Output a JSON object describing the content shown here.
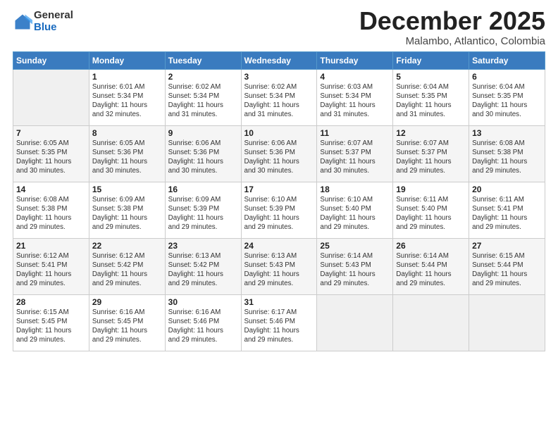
{
  "logo": {
    "general": "General",
    "blue": "Blue"
  },
  "title": "December 2025",
  "subtitle": "Malambo, Atlantico, Colombia",
  "weekdays": [
    "Sunday",
    "Monday",
    "Tuesday",
    "Wednesday",
    "Thursday",
    "Friday",
    "Saturday"
  ],
  "weeks": [
    [
      {
        "date": "",
        "info": ""
      },
      {
        "date": "1",
        "info": "Sunrise: 6:01 AM\nSunset: 5:34 PM\nDaylight: 11 hours\nand 32 minutes."
      },
      {
        "date": "2",
        "info": "Sunrise: 6:02 AM\nSunset: 5:34 PM\nDaylight: 11 hours\nand 31 minutes."
      },
      {
        "date": "3",
        "info": "Sunrise: 6:02 AM\nSunset: 5:34 PM\nDaylight: 11 hours\nand 31 minutes."
      },
      {
        "date": "4",
        "info": "Sunrise: 6:03 AM\nSunset: 5:34 PM\nDaylight: 11 hours\nand 31 minutes."
      },
      {
        "date": "5",
        "info": "Sunrise: 6:04 AM\nSunset: 5:35 PM\nDaylight: 11 hours\nand 31 minutes."
      },
      {
        "date": "6",
        "info": "Sunrise: 6:04 AM\nSunset: 5:35 PM\nDaylight: 11 hours\nand 30 minutes."
      }
    ],
    [
      {
        "date": "7",
        "info": "Sunrise: 6:05 AM\nSunset: 5:35 PM\nDaylight: 11 hours\nand 30 minutes."
      },
      {
        "date": "8",
        "info": "Sunrise: 6:05 AM\nSunset: 5:36 PM\nDaylight: 11 hours\nand 30 minutes."
      },
      {
        "date": "9",
        "info": "Sunrise: 6:06 AM\nSunset: 5:36 PM\nDaylight: 11 hours\nand 30 minutes."
      },
      {
        "date": "10",
        "info": "Sunrise: 6:06 AM\nSunset: 5:36 PM\nDaylight: 11 hours\nand 30 minutes."
      },
      {
        "date": "11",
        "info": "Sunrise: 6:07 AM\nSunset: 5:37 PM\nDaylight: 11 hours\nand 30 minutes."
      },
      {
        "date": "12",
        "info": "Sunrise: 6:07 AM\nSunset: 5:37 PM\nDaylight: 11 hours\nand 29 minutes."
      },
      {
        "date": "13",
        "info": "Sunrise: 6:08 AM\nSunset: 5:38 PM\nDaylight: 11 hours\nand 29 minutes."
      }
    ],
    [
      {
        "date": "14",
        "info": "Sunrise: 6:08 AM\nSunset: 5:38 PM\nDaylight: 11 hours\nand 29 minutes."
      },
      {
        "date": "15",
        "info": "Sunrise: 6:09 AM\nSunset: 5:38 PM\nDaylight: 11 hours\nand 29 minutes."
      },
      {
        "date": "16",
        "info": "Sunrise: 6:09 AM\nSunset: 5:39 PM\nDaylight: 11 hours\nand 29 minutes."
      },
      {
        "date": "17",
        "info": "Sunrise: 6:10 AM\nSunset: 5:39 PM\nDaylight: 11 hours\nand 29 minutes."
      },
      {
        "date": "18",
        "info": "Sunrise: 6:10 AM\nSunset: 5:40 PM\nDaylight: 11 hours\nand 29 minutes."
      },
      {
        "date": "19",
        "info": "Sunrise: 6:11 AM\nSunset: 5:40 PM\nDaylight: 11 hours\nand 29 minutes."
      },
      {
        "date": "20",
        "info": "Sunrise: 6:11 AM\nSunset: 5:41 PM\nDaylight: 11 hours\nand 29 minutes."
      }
    ],
    [
      {
        "date": "21",
        "info": "Sunrise: 6:12 AM\nSunset: 5:41 PM\nDaylight: 11 hours\nand 29 minutes."
      },
      {
        "date": "22",
        "info": "Sunrise: 6:12 AM\nSunset: 5:42 PM\nDaylight: 11 hours\nand 29 minutes."
      },
      {
        "date": "23",
        "info": "Sunrise: 6:13 AM\nSunset: 5:42 PM\nDaylight: 11 hours\nand 29 minutes."
      },
      {
        "date": "24",
        "info": "Sunrise: 6:13 AM\nSunset: 5:43 PM\nDaylight: 11 hours\nand 29 minutes."
      },
      {
        "date": "25",
        "info": "Sunrise: 6:14 AM\nSunset: 5:43 PM\nDaylight: 11 hours\nand 29 minutes."
      },
      {
        "date": "26",
        "info": "Sunrise: 6:14 AM\nSunset: 5:44 PM\nDaylight: 11 hours\nand 29 minutes."
      },
      {
        "date": "27",
        "info": "Sunrise: 6:15 AM\nSunset: 5:44 PM\nDaylight: 11 hours\nand 29 minutes."
      }
    ],
    [
      {
        "date": "28",
        "info": "Sunrise: 6:15 AM\nSunset: 5:45 PM\nDaylight: 11 hours\nand 29 minutes."
      },
      {
        "date": "29",
        "info": "Sunrise: 6:16 AM\nSunset: 5:45 PM\nDaylight: 11 hours\nand 29 minutes."
      },
      {
        "date": "30",
        "info": "Sunrise: 6:16 AM\nSunset: 5:46 PM\nDaylight: 11 hours\nand 29 minutes."
      },
      {
        "date": "31",
        "info": "Sunrise: 6:17 AM\nSunset: 5:46 PM\nDaylight: 11 hours\nand 29 minutes."
      },
      {
        "date": "",
        "info": ""
      },
      {
        "date": "",
        "info": ""
      },
      {
        "date": "",
        "info": ""
      }
    ]
  ]
}
